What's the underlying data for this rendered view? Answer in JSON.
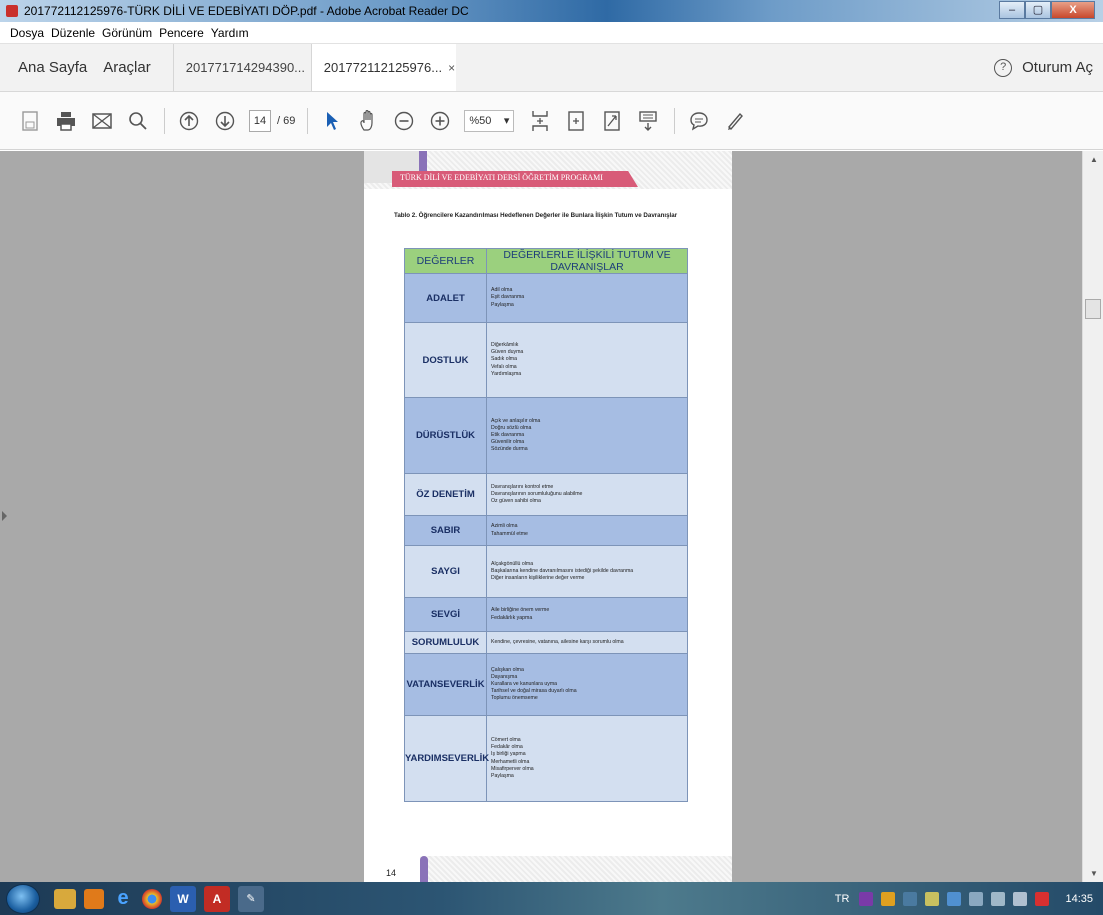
{
  "window": {
    "title": "201772112125976-TÜRK DİLİ VE EDEBİYATI DÖP.pdf - Adobe Acrobat Reader DC",
    "minimize": "–",
    "maximize": "▢",
    "close": "X"
  },
  "menu": [
    "Dosya",
    "Düzenle",
    "Görünüm",
    "Pencere",
    "Yardım"
  ],
  "tabs": {
    "home": "Ana Sayfa",
    "tools": "Araçlar",
    "doc1": "201771714294390...",
    "doc2": "201772112125976...",
    "close_glyph": "×",
    "help": "?",
    "signin": "Oturum Aç"
  },
  "toolbar": {
    "page_current": "14",
    "page_total": "/ 69",
    "zoom": "%50",
    "zoom_arrow": "▾"
  },
  "document": {
    "header_text": "TÜRK DİLİ VE EDEBİYATI DERSİ ÖĞRETİM PROGRAMI",
    "caption": "Tablo 2. Öğrencilere Kazandırılması Hedeflenen Değerler ile Bunlara İlişkin Tutum ve Davranışlar",
    "col1": "DEĞERLER",
    "col2": "DEĞERLERLE İLİŞKİLİ TUTUM VE DAVRANIŞLAR",
    "rows": [
      {
        "name": "ADALET",
        "items": [
          "Adil olma",
          "Eşit davranma",
          "Paylaşma"
        ]
      },
      {
        "name": "DOSTLUK",
        "items": [
          "Diğerkâmlık",
          "Güven duyma",
          "Sadık olma",
          "Vefalı olma",
          "Yardımlaşma"
        ]
      },
      {
        "name": "DÜRÜSTLÜK",
        "items": [
          "Açık ve anlaşılır olma",
          "Doğru sözlü olma",
          "Etik davranma",
          "Güvenilir olma",
          "Sözünde durma"
        ]
      },
      {
        "name": "ÖZ DENETİM",
        "items": [
          "Davranışlarını kontrol etme",
          "Davranışlarının sorumluluğunu alabilme",
          "Öz güven sahibi olma"
        ]
      },
      {
        "name": "SABIR",
        "items": [
          "Azimli olma",
          "Tahammül etme"
        ]
      },
      {
        "name": "SAYGI",
        "items": [
          "Alçakgönüllü olma",
          "Başkalarına kendine davranılmasını istediği şekilde davranma",
          "Diğer insanların kişiliklerine değer verme"
        ]
      },
      {
        "name": "SEVGİ",
        "items": [
          "Aile birliğine önem verme",
          "Fedakârlık yapma"
        ]
      },
      {
        "name": "SORUMLULUK",
        "items": [
          "Kendine, çevresine, vatanına, ailesine karşı sorumlu olma"
        ]
      },
      {
        "name": "VATANSEVERLİK",
        "items": [
          "Çalışkan olma",
          "Dayanışma",
          "Kurallara ve kanunlara uyma",
          "Tarihsel ve doğal mirasa duyarlı olma",
          "Toplumu önemseme"
        ]
      },
      {
        "name": "YARDIMSEVERLİK",
        "items": [
          "Cömert olma",
          "Fedakâr olma",
          "İş birliği yapma",
          "Merhametli olma",
          "Misafirperver olma",
          "Paylaşma"
        ]
      }
    ],
    "page_number": "14"
  },
  "taskbar": {
    "lang": "TR",
    "clock": "14:35"
  },
  "colors": {
    "table_header": "#9bd07e",
    "row_dark": "#a6bde3",
    "row_light": "#d3dff0",
    "header_band": "#d85b78",
    "accent_purple": "#8a72b8"
  }
}
